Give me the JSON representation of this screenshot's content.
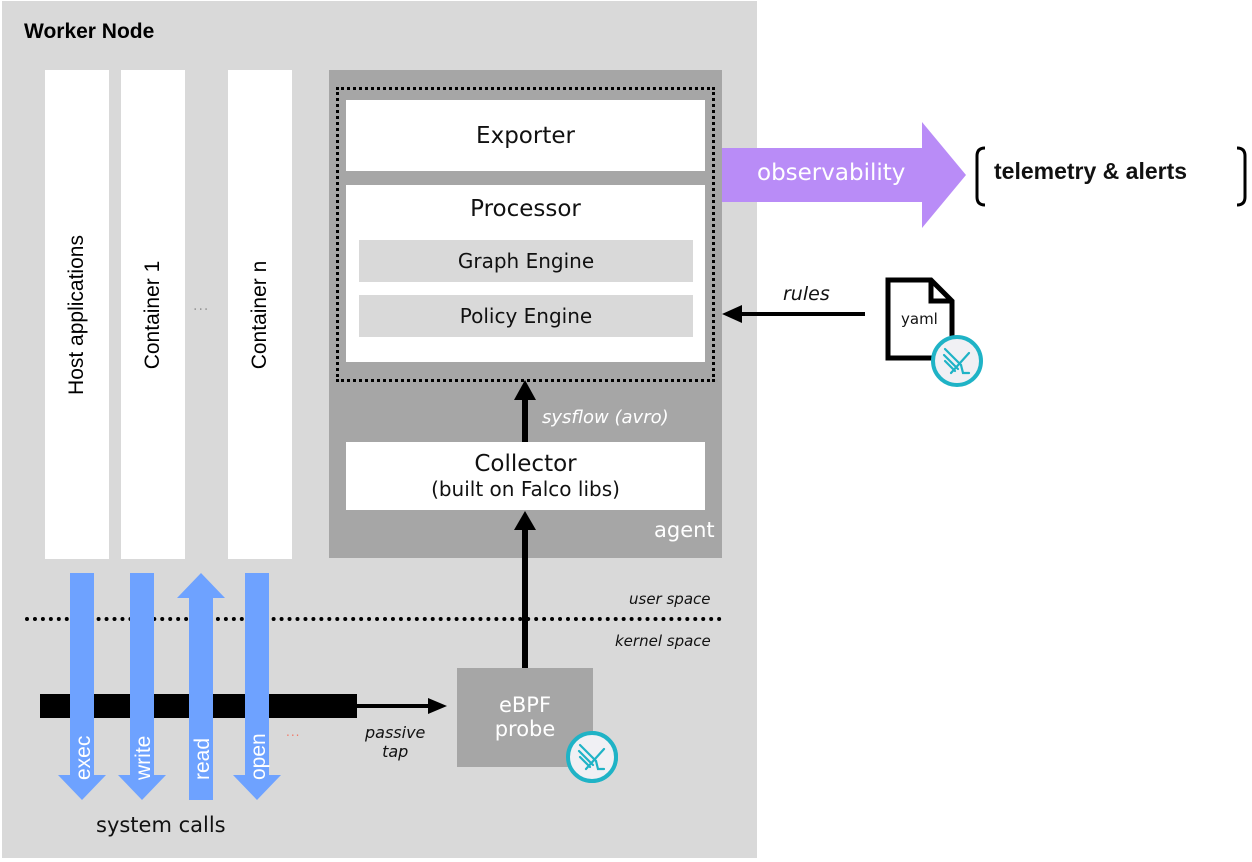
{
  "diagram": {
    "node_title": "Worker Node",
    "columns": [
      {
        "label": "Host applications"
      },
      {
        "label": "Container 1"
      },
      {
        "label": "Container n"
      }
    ],
    "column_ellipsis": "...",
    "agent": {
      "label": "agent",
      "exporter": "Exporter",
      "processor": "Processor",
      "graph_engine": "Graph Engine",
      "policy_engine": "Policy Engine",
      "collector_title": "Collector",
      "collector_subtitle": "(built on Falco libs)",
      "sysflow_label": "sysflow (avro)"
    },
    "observability": {
      "label": "observability",
      "target": "telemetry & alerts",
      "color": "#b98cf7"
    },
    "rules": {
      "label": "rules",
      "file_label": "yaml",
      "file_icon": "document-icon",
      "badge_icon": "falco-logo-icon"
    },
    "spaces": {
      "user": "user space",
      "kernel": "kernel space"
    },
    "probe": {
      "line1": "eBPF",
      "line2": "probe",
      "tap_line1": "passive",
      "tap_line2": "tap"
    },
    "syscalls": {
      "label": "system calls",
      "more": "...",
      "arrow_color": "#6ea2ff",
      "items": [
        {
          "label": "exec",
          "direction": "down"
        },
        {
          "label": "write",
          "direction": "down"
        },
        {
          "label": "read",
          "direction": "up"
        },
        {
          "label": "open",
          "direction": "down"
        }
      ]
    }
  }
}
